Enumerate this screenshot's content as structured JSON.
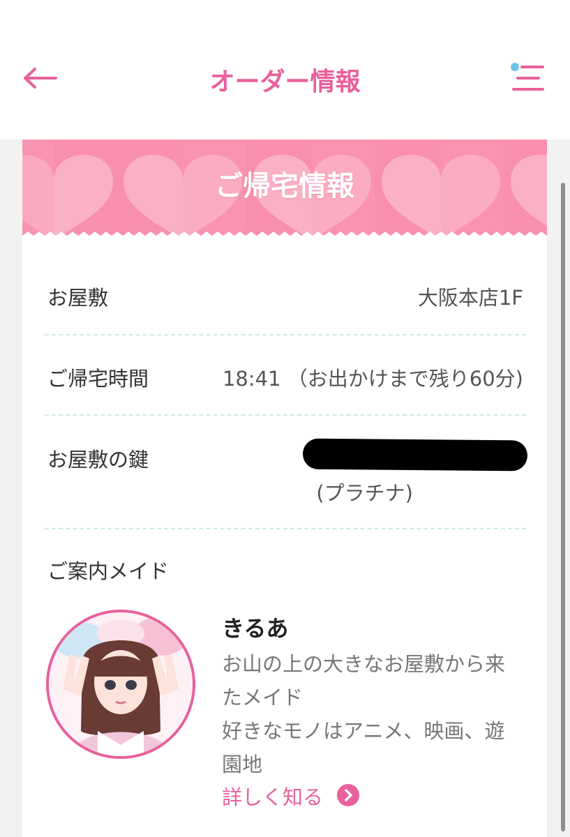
{
  "header": {
    "title": "オーダー情報",
    "back_icon": "arrow-left-icon",
    "menu_icon": "menu-icon",
    "accent_color": "#e8609c"
  },
  "banner": {
    "title": "ご帰宅情報",
    "colors": [
      "#f88fae",
      "#fbb8cb",
      "#ffffff"
    ]
  },
  "info": {
    "mansion_label": "お屋敷",
    "mansion_value": "大阪本店1F",
    "time_label": "ご帰宅時間",
    "time_value": "18:41 （お出かけまで残り60分)",
    "key_label": "お屋敷の鍵",
    "key_rank": "(プラチナ)"
  },
  "maid": {
    "section_label": "ご案内メイド",
    "name": "きるあ",
    "desc_line1": "お山の上の大きなお屋敷から来",
    "desc_line2": "たメイド",
    "desc_line3": "好きなモノはアニメ、映画、遊",
    "desc_line4": "園地",
    "more_label": "詳しく知る",
    "more_icon": "chevron-right-circle-icon"
  }
}
